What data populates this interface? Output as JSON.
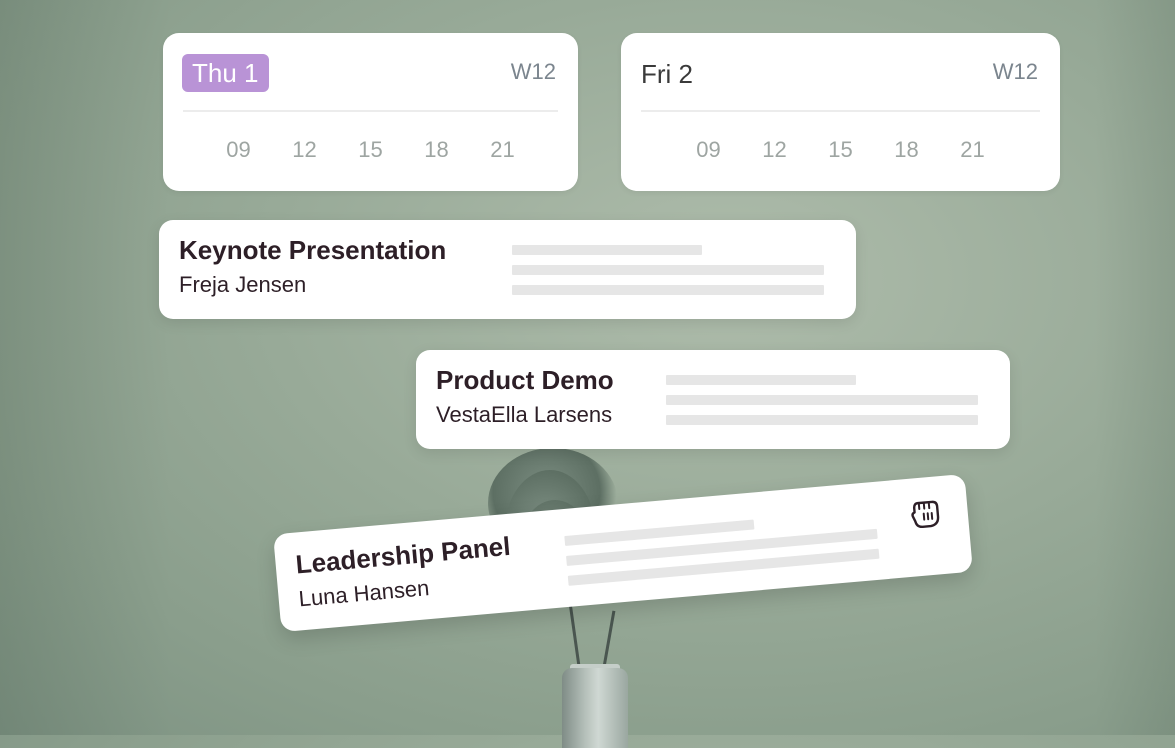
{
  "days": [
    {
      "label": "Thu 1",
      "week": "W12",
      "active": true,
      "hours": [
        "09",
        "12",
        "15",
        "18",
        "21"
      ]
    },
    {
      "label": "Fri 2",
      "week": "W12",
      "active": false,
      "hours": [
        "09",
        "12",
        "15",
        "18",
        "21"
      ]
    }
  ],
  "events": [
    {
      "title": "Keynote Presentation",
      "person": "Freja Jensen"
    },
    {
      "title": "Product Demo",
      "person": "VestaElla Larsens"
    },
    {
      "title": "Leadership Panel",
      "person": "Luna Hansen"
    }
  ],
  "colors": {
    "active_day": "#b993d6",
    "text_dark": "#2d1f27",
    "background": "#98aa98"
  },
  "icons": {
    "drag_cursor": "grab-hand-icon"
  }
}
